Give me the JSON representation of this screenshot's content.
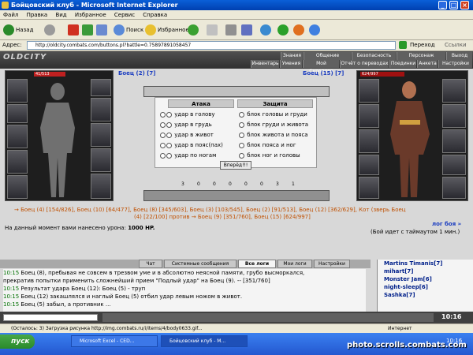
{
  "window": {
    "title": "Бойцовский клуб - Microsoft Internet Explorer"
  },
  "menu": [
    "Файл",
    "Правка",
    "Вид",
    "Избранное",
    "Сервис",
    "Справка"
  ],
  "toolbar": {
    "back": "Назад",
    "search": "Поиск",
    "favorites": "Избранное"
  },
  "address": {
    "label": "Адрес:",
    "url": "http://oldcity.combats.com/buttons.pl?battle=0.75897891058457",
    "go": "Переход",
    "links": "Ссылки"
  },
  "game": {
    "logo": "OLDCITY",
    "nav_top": [
      "Знания",
      "Общение",
      "Безопасность",
      "Персонаж",
      "Выход"
    ],
    "nav_bottom": [
      "Инвентарь",
      "Умения",
      "Мой Скроллер",
      "Отчёт о переводах",
      "Поединки",
      "Анкета",
      "Настройки"
    ],
    "left_fighter": {
      "name": "Боец (2)",
      "hp": "41/513"
    },
    "right_fighter": {
      "name": "Боец (15)",
      "hp": "624/997"
    },
    "attack_header": "Атака",
    "defense_header": "Защита",
    "attacks": [
      "удар в голову",
      "удар в грудь",
      "удар в живот",
      "удар в пояс(пах)",
      "удар по ногам"
    ],
    "defenses": [
      "блок головы и груди",
      "блок груди и живота",
      "блок живота и пояса",
      "блок пояса и ног",
      "блок ног и головы"
    ],
    "forward_button": "Вперёд!!!",
    "counters": [
      "3",
      "0",
      "0",
      "0",
      "0",
      "0",
      "3",
      "1"
    ],
    "team_line": "→ Боец (4) [154/826], Боец (10) [64/477], Боец (8) [345/603], Боец (3) [103/545], Боец (2) [91/513], Боец (12) [362/629], Кот (зверь Боец",
    "team_line2": "(4) [22/100] против → Боец (9) [351/760], Боец (15) [624/997]",
    "battle_log_link": "лог боя »",
    "damage_text": "На данный момент вами нанесено урона:",
    "damage_value": "1000 HP.",
    "timeout_text": "(Бой идет с таймаутом 1 мин.)"
  },
  "chat": {
    "tabs": [
      "Чат",
      "Системные сообщения",
      "Все логи",
      "Мои логи",
      "Настройки"
    ],
    "lines": [
      {
        "time": "10:15",
        "text": "Боец (8), пребывая не совсем в трезвом уме и в абсолютно неясной памяти, грубо высморкался,"
      },
      {
        "time": "",
        "text": "прекратив попытки применить сложнейший прием \"Подлый удар\" на Боец (9). -- [351/760]"
      },
      {
        "time": "10:15",
        "text": "Результат удара Боец (12): Боец (5) - труп"
      },
      {
        "time": "10:15",
        "text": "Боец (12) закашлялся и наглый Боец (5) отбил удар левым ножом в живот."
      },
      {
        "time": "10:15",
        "text": "Боец (5) забыл, а противник ..."
      }
    ]
  },
  "users": [
    "Martins Timanis[7]",
    "mihart[7]",
    "Monster Jam[6]",
    "night-sleep[6]",
    "Sashka[7]"
  ],
  "clock": "10:16",
  "statusbar": "(Осталось: 3) Загрузка рисунка http://img.combats.ru/i/items/4/body0633.gif...",
  "status_zone": "Интернет",
  "taskbar": {
    "start": "пуск",
    "tasks": [
      "Microsoft Excel - CED...",
      "Бойцовский клуб - M..."
    ],
    "time": "10:16"
  },
  "watermark": "photo.scrolls.combats.com"
}
